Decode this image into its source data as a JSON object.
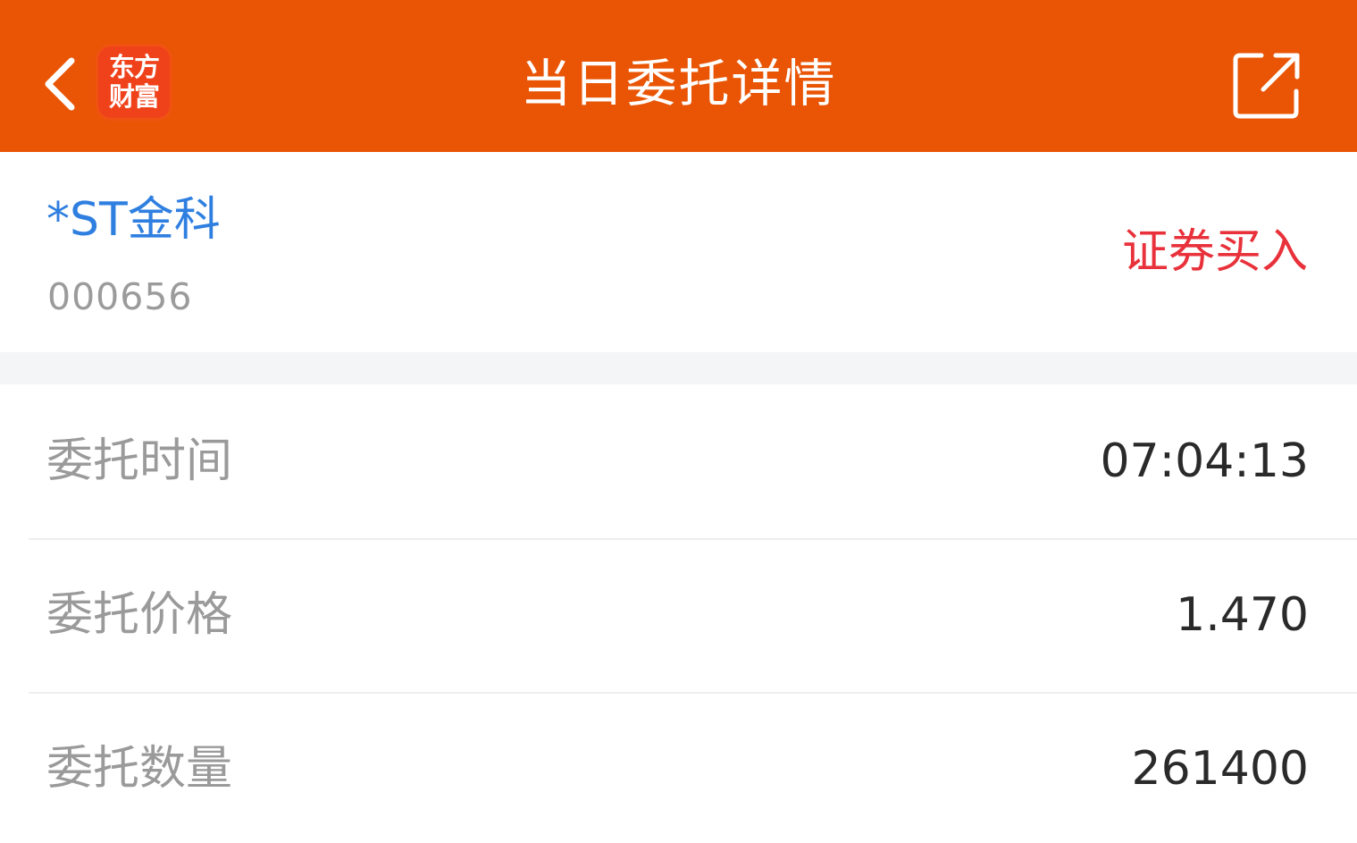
{
  "header": {
    "title": "当日委托详情",
    "logo_line1": "东方",
    "logo_line2": "财富",
    "back_icon": "chevron-left-icon",
    "share_icon": "share-external-icon"
  },
  "stock": {
    "name": "*ST金科",
    "code": "000656",
    "trade_type": "证券买入"
  },
  "details": {
    "rows": [
      {
        "label": "委托时间",
        "value": "07:04:13"
      },
      {
        "label": "委托价格",
        "value": "1.470"
      },
      {
        "label": "委托数量",
        "value": "261400"
      }
    ]
  },
  "colors": {
    "header_bg": "#e95505",
    "stock_name": "#2f7fe0",
    "trade_type": "#e8313a",
    "label": "#9a9a9a",
    "value": "#2a2a2a"
  }
}
